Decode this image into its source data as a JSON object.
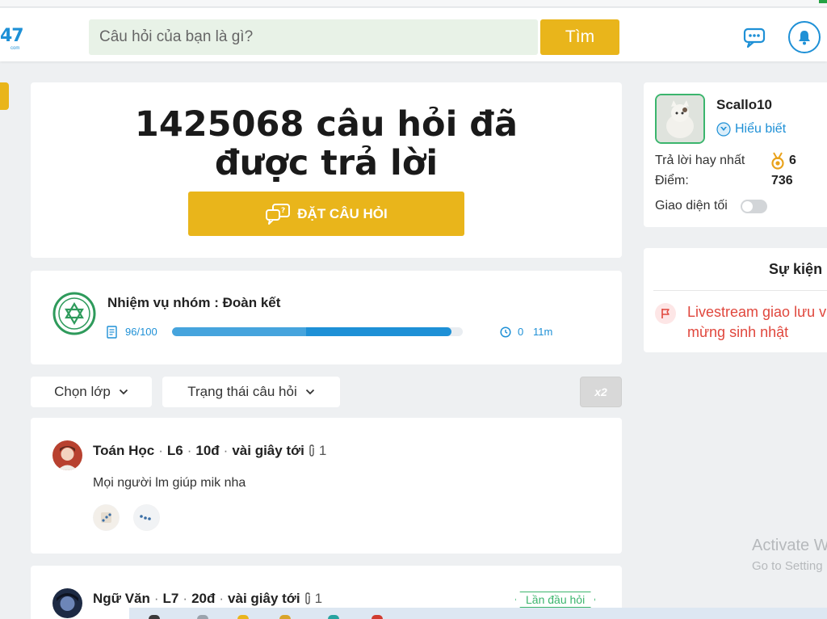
{
  "header": {
    "logo_text": "47",
    "logo_sub": "com",
    "search_placeholder": "Câu hỏi của bạn là gì?",
    "search_button": "Tìm"
  },
  "hero": {
    "title_line1": "1425068 câu hỏi đã",
    "title_line2": "được trả lời",
    "ask_button": "ĐẶT CÂU HỎI"
  },
  "mission": {
    "title": "Nhiệm vụ nhóm : Đoàn kết",
    "count_text": "96/100",
    "progress": 0.96,
    "timer_days": "0",
    "timer_mins": "11m"
  },
  "filters": {
    "class_label": "Chọn lớp",
    "status_label": "Trạng thái câu hỏi",
    "x2_label": "x2"
  },
  "questions": [
    {
      "subject": "Toán Học",
      "grade": "L6",
      "points": "10đ",
      "time": "vài giây tới",
      "attachments": "1",
      "text": "Mọi người lm giúp mik nha"
    },
    {
      "subject": "Ngữ Văn",
      "grade": "L7",
      "points": "20đ",
      "time": "vài giây tới",
      "attachments": "1",
      "badge": "Lần đầu hỏi"
    }
  ],
  "profile": {
    "name": "Scallo10",
    "rank": "Hiểu biết",
    "best_answers_label": "Trả lời hay nhất",
    "best_answers_value": "6",
    "points_label": "Điểm:",
    "points_value": "736",
    "dark_mode_label": "Giao diện tối"
  },
  "events": {
    "title": "Sự kiện",
    "item_line1": "Livestream giao lưu v",
    "item_line2": "mừng sinh nhật"
  },
  "watermark": {
    "line1": "Activate W",
    "line2": "Go to Setting"
  },
  "colors": {
    "accent_yellow": "#e9b51b",
    "brand_blue": "#1e90d6",
    "success_green": "#3bb56d",
    "event_red": "#e0473d",
    "background": "#eef0f2"
  }
}
